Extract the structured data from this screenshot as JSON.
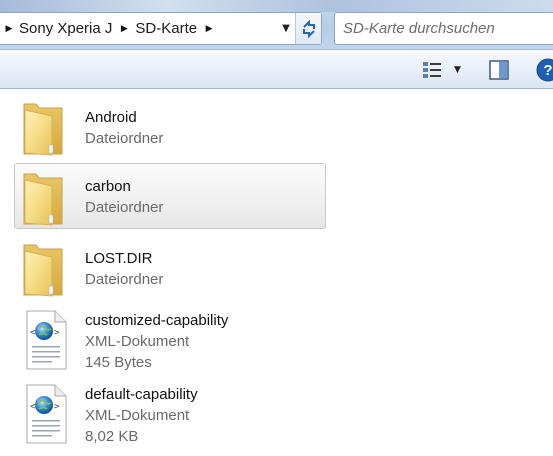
{
  "address": {
    "breadcrumbs": [
      "Sony Xperia J",
      "SD-Karte"
    ]
  },
  "search": {
    "placeholder": "SD-Karte durchsuchen"
  },
  "toolbar": {
    "icons": [
      "change-view-icon",
      "preview-pane-icon",
      "help-icon"
    ]
  },
  "files": [
    {
      "name": "Android",
      "type": "Dateiordner",
      "icon": "folder-icon"
    },
    {
      "name": "carbon",
      "type": "Dateiordner",
      "icon": "folder-icon",
      "selected": true
    },
    {
      "name": "LOST.DIR",
      "type": "Dateiordner",
      "icon": "folder-icon"
    },
    {
      "name": "customized-capability",
      "type": "XML-Dokument",
      "size": "145 Bytes",
      "icon": "xml-document-icon"
    },
    {
      "name": "default-capability",
      "type": "XML-Dokument",
      "size": "8,02 KB",
      "icon": "xml-document-icon"
    }
  ],
  "colors": {
    "titlebar": "#c2d5ec",
    "selection": "#e6e6e6",
    "folder": "#f2d47a",
    "help": "#1f5fb2"
  }
}
